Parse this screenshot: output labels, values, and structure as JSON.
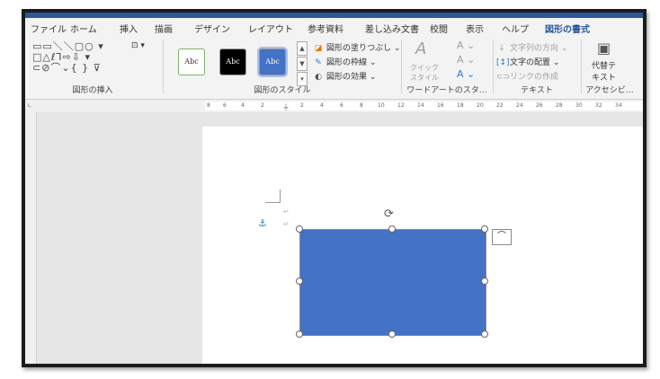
{
  "ribbon_tabs": [
    "ファイル",
    "ホーム",
    "挿入",
    "描画",
    "デザイン",
    "レイアウト",
    "参考資料",
    "差し込み文書",
    "校閲",
    "表示",
    "ヘルプ",
    "図形の書式"
  ],
  "active_tab": "図形の書式",
  "groups": {
    "insert_shapes": {
      "label": "図形の挿入",
      "shape_glyphs_row1": "▭▭＼＼▢○ ▾",
      "shape_glyphs_row2": "□△ℓ⅂⇨⇩ ▾",
      "shape_glyphs_row3": "⊂⊘⌒⌄{ } ⊽",
      "text_box_icon": "⊡ ▾"
    },
    "shape_styles": {
      "label": "図形のスタイル",
      "style_previews": [
        "Abc",
        "Abc",
        "Abc"
      ],
      "fill": "図形の塗りつぶし",
      "outline": "図形の枠線",
      "effects": "図形の効果"
    },
    "wordart": {
      "label": "ワードアートのスタ…",
      "quick_style_line1": "クイック",
      "quick_style_line2": "スタイル"
    },
    "text": {
      "label": "テキスト",
      "text_direction": "文字列の方向",
      "align_text": "文字の配置",
      "create_link": "リンクの作成"
    },
    "accessibility": {
      "label": "アクセシビ…",
      "alt_text_line1": "代替テ",
      "alt_text_line2": "キスト"
    }
  },
  "ruler": {
    "ticks": [
      "8",
      "6",
      "4",
      "2",
      "",
      "2",
      "4",
      "6",
      "8",
      "10",
      "12",
      "14",
      "16",
      "18",
      "20",
      "22",
      "24",
      "26",
      "28",
      "30",
      "32",
      "34"
    ]
  },
  "colors": {
    "shape_fill": "#4472c4",
    "accent": "#2b579a"
  }
}
